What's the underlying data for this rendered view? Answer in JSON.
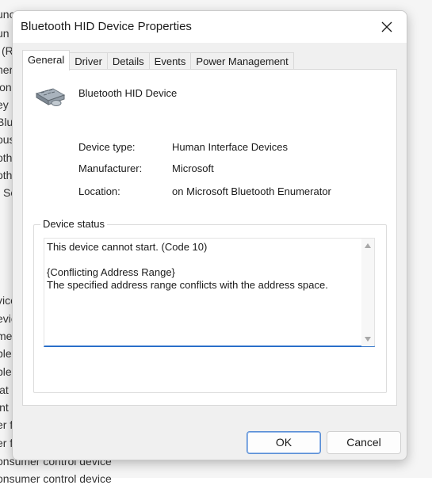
{
  "background_list": [
    "unc",
    "un",
    "(R",
    "ner",
    "ion",
    "ey",
    "Blu",
    "ous",
    "oth",
    "oth",
    "Se",
    "vice",
    "evic",
    "mer",
    "ble",
    "ble",
    "lat",
    "int",
    "er f",
    "er f",
    "onsumer control device",
    "onsumer control device"
  ],
  "dialog": {
    "title": "Bluetooth HID Device Properties",
    "close_icon": "close-icon"
  },
  "tabs": [
    {
      "label": "General",
      "active": true
    },
    {
      "label": "Driver",
      "active": false
    },
    {
      "label": "Details",
      "active": false
    },
    {
      "label": "Events",
      "active": false
    },
    {
      "label": "Power Management",
      "active": false
    }
  ],
  "device": {
    "icon": "bluetooth-hid-device-icon",
    "name": "Bluetooth HID Device",
    "properties": [
      {
        "label": "Device type:",
        "value": "Human Interface Devices"
      },
      {
        "label": "Manufacturer:",
        "value": "Microsoft"
      },
      {
        "label": "Location:",
        "value": "on Microsoft Bluetooth Enumerator"
      }
    ]
  },
  "status": {
    "group_title": "Device status",
    "line1": "This device cannot start. (Code 10)",
    "line2": "",
    "line3": "{Conflicting Address Range}",
    "line4": "The specified address range conflicts with the address space."
  },
  "buttons": {
    "ok": "OK",
    "cancel": "Cancel"
  }
}
